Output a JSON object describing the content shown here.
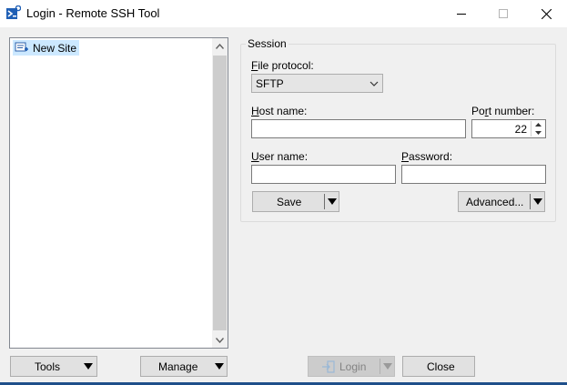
{
  "window": {
    "title": "Login - Remote SSH Tool",
    "icon": "app-terminal-icon",
    "controls": [
      "minimize-icon",
      "maximize-icon",
      "close-icon"
    ]
  },
  "tree": {
    "items": [
      {
        "label": "New Site",
        "icon": "new-site-icon",
        "selected": true
      }
    ]
  },
  "session": {
    "group_label": "Session",
    "file_protocol": {
      "label_accel": "F",
      "label_rest": "ile protocol:",
      "value": "SFTP"
    },
    "host": {
      "label_accel": "H",
      "label_rest": "ost name:",
      "value": ""
    },
    "port": {
      "label_accel": "",
      "label_lead": "Po",
      "label_u": "r",
      "label_rest": "t number:",
      "value": "22"
    },
    "user": {
      "label_accel": "U",
      "label_rest": "ser name:",
      "value": ""
    },
    "password": {
      "label_accel": "P",
      "label_rest": "assword:",
      "value": ""
    },
    "save_label": "Save",
    "advanced_label": "Advanced..."
  },
  "footer": {
    "tools_label": "Tools",
    "manage_label": "Manage",
    "login_label": "Login",
    "close_label": "Close"
  },
  "colors": {
    "accent": "#1e4f8a",
    "selection": "#cce8ff",
    "window_bg": "#f0f0f0"
  }
}
